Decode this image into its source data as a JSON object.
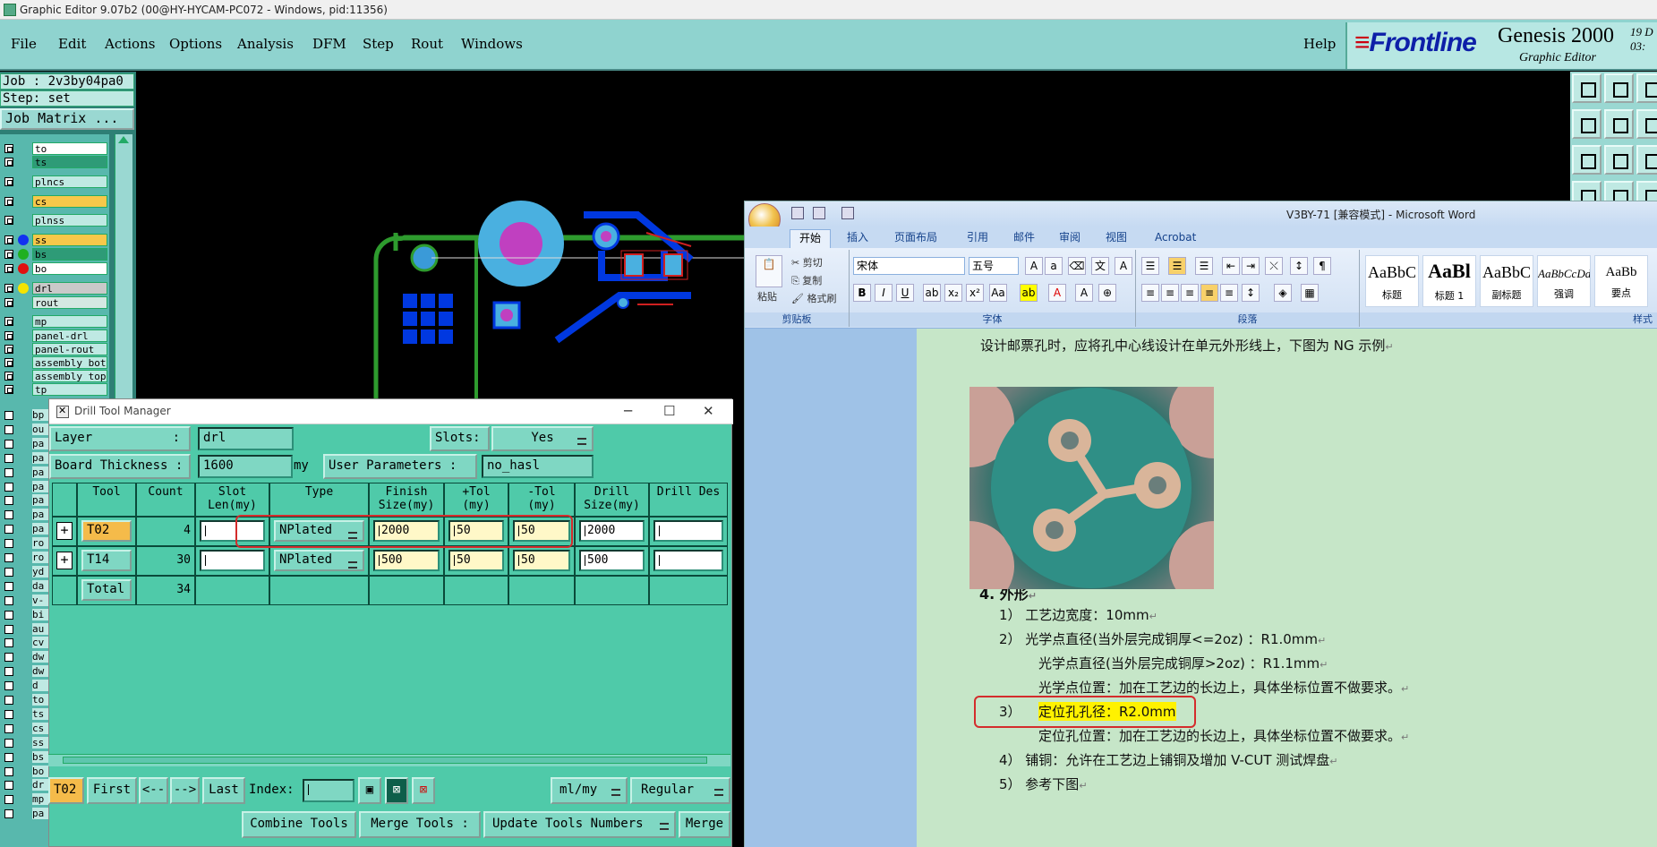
{
  "window": {
    "title": "Graphic Editor 9.07b2 (00@HY-HYCAM-PC072 - Windows, pid:11356)"
  },
  "menu": {
    "items": [
      "File",
      "Edit",
      "Actions",
      "Options",
      "Analysis",
      "DFM",
      "Step",
      "Rout",
      "Windows"
    ],
    "help": "Help"
  },
  "logo": {
    "brand": "Frontline",
    "product": "Genesis 2000",
    "subtitle": "Graphic Editor",
    "date_line1": "19 D",
    "date_line2": "03:"
  },
  "leftpanel": {
    "job": "Job : 2v3by04pa0",
    "step": "Step: set",
    "job_matrix": "Job Matrix ...",
    "layers": [
      {
        "name": "to",
        "bg": "#ffffff",
        "dot": ""
      },
      {
        "name": "ts",
        "bg": "#2e9b77",
        "dot": ""
      },
      {
        "name": "plncs",
        "bg": "#bfe9e3",
        "dot": ""
      },
      {
        "name": "cs",
        "bg": "#f7c84a",
        "dot": ""
      },
      {
        "name": "plnss",
        "bg": "#bfe9e3",
        "dot": ""
      },
      {
        "name": "ss",
        "bg": "#f7c84a",
        "dot": "#1232f0"
      },
      {
        "name": "bs",
        "bg": "#2e9b77",
        "dot": "#20b020"
      },
      {
        "name": "bo",
        "bg": "#ffffff",
        "dot": "#e01010"
      },
      {
        "name": "drl",
        "bg": "#c9c9c9",
        "dot": "#f5e400"
      },
      {
        "name": "rout",
        "bg": "#d4e8e2",
        "dot": ""
      },
      {
        "name": "mp",
        "bg": "#bfe9e3",
        "dot": ""
      },
      {
        "name": "panel-drl",
        "bg": "#bfe9e3",
        "dot": ""
      },
      {
        "name": "panel-rout",
        "bg": "#bfe9e3",
        "dot": ""
      },
      {
        "name": "assembly_bot",
        "bg": "#bfe9e3",
        "dot": ""
      },
      {
        "name": "assembly_top",
        "bg": "#bfe9e3",
        "dot": ""
      },
      {
        "name": "tp",
        "bg": "#bfe9e3",
        "dot": ""
      }
    ],
    "short_layers": [
      "bp",
      "ou",
      "pa",
      "pa",
      "pa",
      "pa",
      "pa",
      "pa",
      "pa",
      "ro",
      "ro",
      "yd",
      "da",
      "v-",
      "bi",
      "au",
      "cv",
      "dw",
      "dw",
      "d",
      "to",
      "ts",
      "cs",
      "ss",
      "bs",
      "bo",
      "dr",
      "mp",
      "pa"
    ]
  },
  "dtm": {
    "title": "Drill Tool Manager",
    "layer_label": "Layer",
    "layer_colon": ":",
    "layer_value": "drl",
    "slots_label": "Slots:",
    "slots_value": "Yes",
    "thickness_label": "Board Thickness :",
    "thickness_value": "1600",
    "thickness_unit": "my",
    "user_params_label": "User Parameters :",
    "user_params_value": "no_hasl",
    "headers": [
      "Tool",
      "Count",
      "Slot Len(my)",
      "Type",
      "Finish Size(my)",
      "+Tol (my)",
      "-Tol (my)",
      "Drill Size(my)",
      "Drill Des"
    ],
    "rows": [
      {
        "tool": "T02",
        "count": "4",
        "slot": "",
        "type": "NPlated",
        "finish": "2000",
        "ptol": "50",
        "ntol": "50",
        "drill": "2000",
        "des": ""
      },
      {
        "tool": "T14",
        "count": "30",
        "slot": "",
        "type": "NPlated",
        "finish": "500",
        "ptol": "50",
        "ntol": "50",
        "drill": "500",
        "des": ""
      }
    ],
    "total_label": "Total",
    "total_count": "34",
    "nav": {
      "current": "T02",
      "first": "First",
      "prev": "<--",
      "next": "-->",
      "last": "Last",
      "index_label": "Index:",
      "units": "ml/my",
      "mode": "Regular"
    },
    "actions": {
      "combine": "Combine Tools",
      "merge_label": "Merge Tools :",
      "update": "Update Tools Numbers",
      "merge": "Merge"
    }
  },
  "word": {
    "title": "V3BY-71 [兼容模式] - Microsoft Word",
    "tabs": [
      "开始",
      "插入",
      "页面布局",
      "引用",
      "邮件",
      "审阅",
      "视图",
      "Acrobat"
    ],
    "clipboard": {
      "paste": "粘贴",
      "cut": "剪切",
      "copy": "复制",
      "format": "格式刷",
      "label": "剪贴板"
    },
    "font": {
      "name": "宋体",
      "size": "五号",
      "label": "字体"
    },
    "paragraph_label": "段落",
    "styles": [
      {
        "preview": "AaBbC",
        "name": "标题"
      },
      {
        "preview": "AaBl",
        "name": "标题 1"
      },
      {
        "preview": "AaBbC",
        "name": "副标题"
      },
      {
        "preview": "AaBbCcDd",
        "name": "强调"
      },
      {
        "preview": "AaBb",
        "name": "要点"
      }
    ],
    "styles_label": "样式",
    "doc": {
      "line1": "设计邮票孔时，应将孔中心线设计在单元外形线上，下图为 NG 示例",
      "heading": "4. 外形",
      "items": [
        "1） 工艺边宽度：10mm",
        "2） 光学点直径(当外层完成铜厚<=2oz) ：R1.0mm",
        "光学点直径(当外层完成铜厚>2oz) ：R1.1mm",
        "光学点位置：加在工艺边的长边上，具体坐标位置不做要求。",
        "3）",
        "定位孔孔径：R2.0mm",
        "定位孔位置：加在工艺边的长边上，具体坐标位置不做要求。",
        "4） 铺铜：允许在工艺边上铺铜及增加 V-CUT 测试焊盘",
        "5） 参考下图"
      ]
    }
  }
}
